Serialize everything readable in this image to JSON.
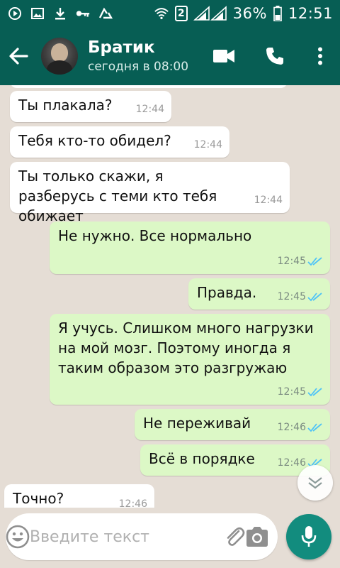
{
  "status_bar": {
    "battery": "36%",
    "time": "12:51",
    "sim": "2",
    "icons": [
      "play-icon",
      "image-icon",
      "download-icon",
      "key-icon",
      "recycle-icon",
      "wifi-icon",
      "signal-icon",
      "battery-icon"
    ]
  },
  "header": {
    "contact_name": "Братик",
    "last_seen": "сегодня в 08:00",
    "icons": [
      "back-arrow-icon",
      "video-call-icon",
      "phone-icon",
      "more-vert-icon"
    ]
  },
  "messages": [
    {
      "dir": "in",
      "text": "Ты плакала?",
      "time": "12:44"
    },
    {
      "dir": "in",
      "text": "Тебя кто-то обидел?",
      "time": "12:44"
    },
    {
      "dir": "in",
      "text": "Ты только скажи, я разберусь с теми кто тебя обижает",
      "time": "12:44"
    },
    {
      "dir": "out",
      "text": "Не нужно. Все нормально",
      "time": "12:45",
      "status": "read"
    },
    {
      "dir": "out",
      "text": "Правда.",
      "time": "12:45",
      "status": "read"
    },
    {
      "dir": "out",
      "text": "Я учусь. Слишком много нагрузки на мой мозг. Поэтому иногда я таким образом это разгружаю",
      "time": "12:45",
      "status": "read"
    },
    {
      "dir": "out",
      "text": "Не переживай",
      "time": "12:46",
      "status": "read"
    },
    {
      "dir": "out",
      "text": "Всё в порядке",
      "time": "12:46",
      "status": "read"
    },
    {
      "dir": "in",
      "text": "Точно?",
      "time": "12:46"
    }
  ],
  "input": {
    "placeholder": "Введите текст",
    "value": ""
  },
  "colors": {
    "header": "#075e54",
    "accent": "#128c7e",
    "incoming_bubble": "#ffffff",
    "outgoing_bubble": "#dcf8c6",
    "read_ticks": "#4fc3f7",
    "chat_bg": "#e5ddd5"
  }
}
